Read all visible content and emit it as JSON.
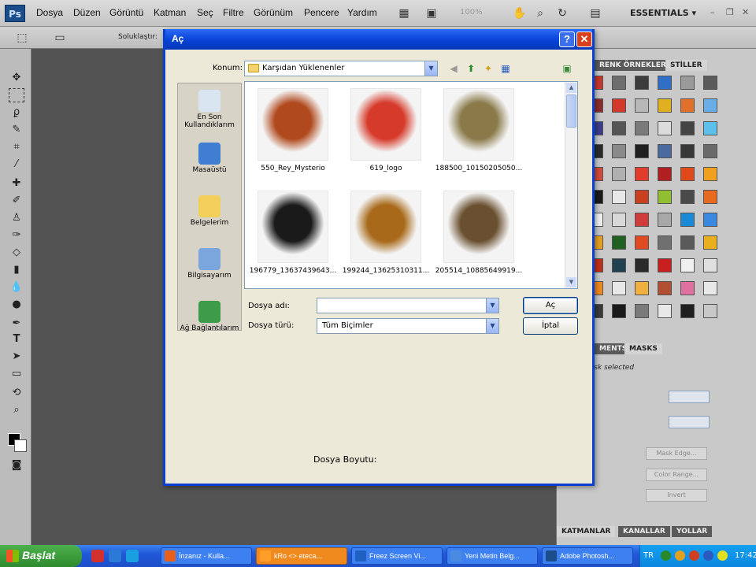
{
  "photoshop": {
    "logo": "Ps",
    "menu": [
      "Dosya",
      "Düzen",
      "Görüntü",
      "Katman",
      "Seç",
      "Filtre",
      "Görünüm",
      "Pencere",
      "Yardım"
    ],
    "zoom": "100%",
    "workspace": "ESSENTIALS ▾",
    "options_label": "Soluklaştır:"
  },
  "panels": {
    "swatch_tabs": [
      "RENK ÖRNEKLERİ",
      "STİLLER"
    ],
    "mask_tabs": [
      "MENTS",
      "MASKS"
    ],
    "mask_text": "mask selected",
    "mask_buttons": [
      "Mask Edge...",
      "Color Range...",
      "Invert"
    ],
    "layer_tabs": [
      "KATMANLAR",
      "KANALLAR",
      "YOLLAR"
    ],
    "swatch_colors": [
      "#c8372d",
      "#6e6e6e",
      "#3c3c3c",
      "#2f6fc5",
      "#9a9a9a",
      "#5a5a5a",
      "#8c2c2c",
      "#d13a2a",
      "#b8b8b8",
      "#e0b020",
      "#e0702a",
      "#69aee6",
      "#3d3d8a",
      "#555555",
      "#7a7a7a",
      "#dcdcdc",
      "#444444",
      "#5cc0ea",
      "#2a2a2a",
      "#8a8a8a",
      "#202020",
      "#4a6aa0",
      "#383838",
      "#6a6a6a",
      "#d24a3a",
      "#b0b0b0",
      "#e23c2c",
      "#b02020",
      "#e04a1a",
      "#f0a020",
      "#1a1a1a",
      "#e8e8e8",
      "#c84020",
      "#90c030",
      "#4a4a4a",
      "#e86a20",
      "#f0f0f0",
      "#d8d8d8",
      "#d03c3c",
      "#a8a8a8",
      "#1a8ad8",
      "#3a88e0",
      "#e8a020",
      "#206020",
      "#e04a20",
      "#707070",
      "#5a5a5a",
      "#e8b020",
      "#c03018",
      "#204050",
      "#2a2a2a",
      "#c82020",
      "#f0f0f0",
      "#e0e0e0",
      "#f08a20",
      "#e8e8e8",
      "#f0b040",
      "#b05030",
      "#e070a0",
      "#e8e8e8",
      "#3a3a3a",
      "#1a1a1a",
      "#7a7a7a",
      "#e8e8e8",
      "#202020",
      "#c8c8c8"
    ]
  },
  "dialog": {
    "title": "Aç",
    "help": "?",
    "close": "✕",
    "location_label": "Konum:",
    "location_value": "Karşıdan Yüklenenler",
    "places": [
      {
        "label": "En Son Kullandıklarım",
        "color": "#d9e6f2"
      },
      {
        "label": "Masaüstü",
        "color": "#3f7ed1"
      },
      {
        "label": "Belgelerim",
        "color": "#f2cf5b"
      },
      {
        "label": "Bilgisayarım",
        "color": "#7aa5dd"
      },
      {
        "label": "Ağ Bağlantılarım",
        "color": "#3e9b4a"
      }
    ],
    "files": [
      {
        "name": "550_Rey_Mysterio",
        "color": "#b04a1e"
      },
      {
        "name": "619_logo",
        "color": "#d63a2a"
      },
      {
        "name": "188500_10150205050...",
        "color": "#8a7a4a"
      },
      {
        "name": "196779_13637439643...",
        "color": "#1a1a1a"
      },
      {
        "name": "199244_13625310311...",
        "color": "#a86a1a"
      },
      {
        "name": "205514_10885649919...",
        "color": "#6a5030"
      }
    ],
    "filename_label": "Dosya adı:",
    "filename_value": "",
    "filetype_label": "Dosya türü:",
    "filetype_value": "Tüm Biçimler",
    "open_button": "Aç",
    "cancel_button": "İptal",
    "size_label": "Dosya Boyutu:"
  },
  "taskbar": {
    "start": "Başlat",
    "tasks": [
      {
        "label": "İnzanız - Kulla...",
        "color": "#e8601a",
        "active": false
      },
      {
        "label": "kRo <> eteca...",
        "color": "#ff9f2a",
        "active": true
      },
      {
        "label": "Freez Screen Vi...",
        "color": "#2060c0",
        "active": false
      },
      {
        "label": "Yeni Metin Belg...",
        "color": "#4a8ae0",
        "active": false
      },
      {
        "label": "Adobe Photosh...",
        "color": "#1b4d8a",
        "active": false
      }
    ],
    "lang": "TR",
    "clock": "17:42"
  }
}
